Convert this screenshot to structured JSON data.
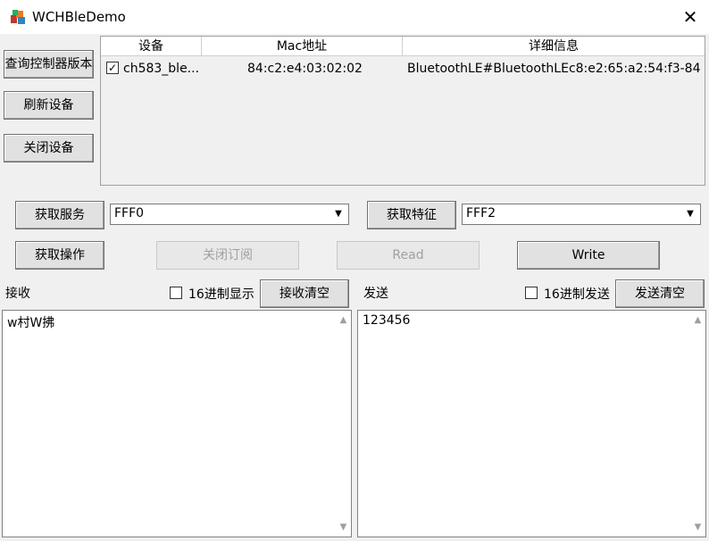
{
  "window": {
    "title": "WCHBleDemo"
  },
  "left_buttons": {
    "query_version": "查询控制器版本",
    "refresh_devices": "刷新设备",
    "close_device": "关闭设备"
  },
  "device_list": {
    "columns": [
      "设备",
      "Mac地址",
      "详细信息"
    ],
    "rows": [
      {
        "checked": true,
        "device": "ch583_ble...",
        "mac": "84:c2:e4:03:02:02",
        "details": "BluetoothLE#BluetoothLEc8:e2:65:a2:54:f3-84:..."
      }
    ]
  },
  "service": {
    "button": "获取服务",
    "value": "FFF0"
  },
  "characteristic": {
    "button": "获取特征",
    "value": "FFF2"
  },
  "actions": {
    "get_operation": "获取操作",
    "close_subscribe": "关闭订阅",
    "read": "Read",
    "write": "Write"
  },
  "receive": {
    "label": "接收",
    "hex_label": "16进制显示",
    "clear": "接收清空",
    "text": "w村W拂"
  },
  "send": {
    "label": "发送",
    "hex_label": "16进制发送",
    "clear": "发送清空",
    "text": "123456"
  }
}
